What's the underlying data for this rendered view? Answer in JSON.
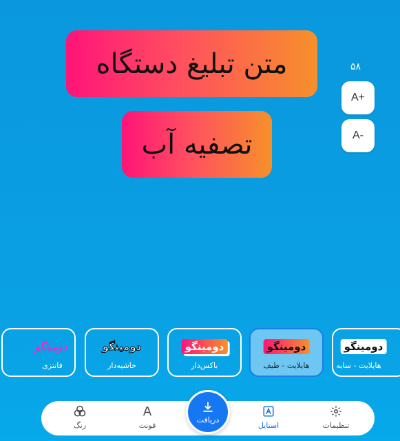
{
  "canvas_text": {
    "line1": "متن تبلیغ دستگاه",
    "line2": "تصفیه آب"
  },
  "font_size": {
    "value": "۵۸",
    "increase_label": "A+",
    "decrease_label": "A-"
  },
  "styles": {
    "items": [
      {
        "sample": "دومینگو",
        "label": "فانتزی"
      },
      {
        "sample": "دومینگو",
        "label": "حاشیه‌دار"
      },
      {
        "sample": "دومینگو",
        "label": "باکس‌دار"
      },
      {
        "sample": "دومینگو",
        "label": "هایلایت - طیف"
      },
      {
        "sample": "دومینگو",
        "label": "هایلایت - سایه"
      }
    ],
    "selected_index": 3
  },
  "nav": {
    "settings": "تنظیمات",
    "style": "استایل",
    "download": "دریافت",
    "font": "فونت",
    "color": "رنگ"
  },
  "colors": {
    "accent": "#1677f2",
    "gradient_start": "#ff1478",
    "gradient_end": "#f7902a"
  }
}
